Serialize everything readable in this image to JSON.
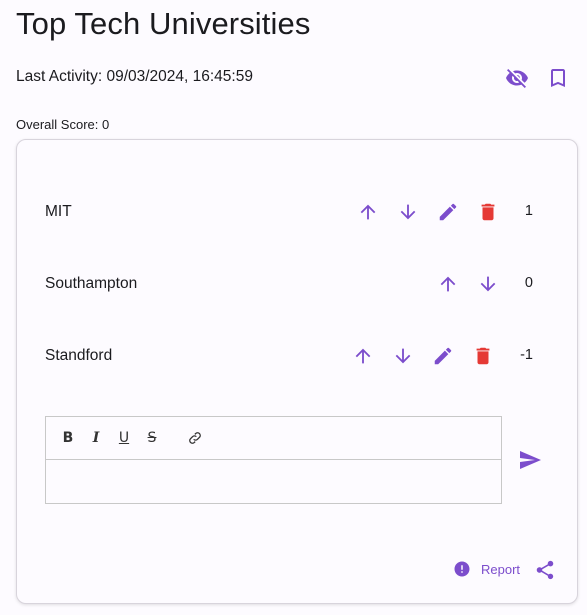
{
  "page": {
    "title": "Top Tech Universities",
    "last_activity": "Last Activity: 09/03/2024, 16:45:59",
    "overall_score": "Overall Score: 0"
  },
  "icons": {
    "hide": "visibility-off-icon",
    "bookmark": "bookmark-icon",
    "upvote": "arrow-up-icon",
    "downvote": "arrow-down-icon",
    "edit": "pencil-icon",
    "delete": "trash-icon",
    "send": "send-icon",
    "report": "alert-circle-icon",
    "share": "share-icon"
  },
  "colors": {
    "accent": "#7c4dcc",
    "danger": "#e53935"
  },
  "items": [
    {
      "name": "MIT",
      "score": "1"
    },
    {
      "name": "Southampton",
      "score": "0"
    },
    {
      "name": "Standford",
      "score": "-1"
    }
  ],
  "editor": {
    "toolbar": {
      "bold": "B",
      "italic": "I",
      "underline": "U",
      "strike": "S"
    },
    "value": ""
  },
  "footer": {
    "report_label": "Report"
  }
}
